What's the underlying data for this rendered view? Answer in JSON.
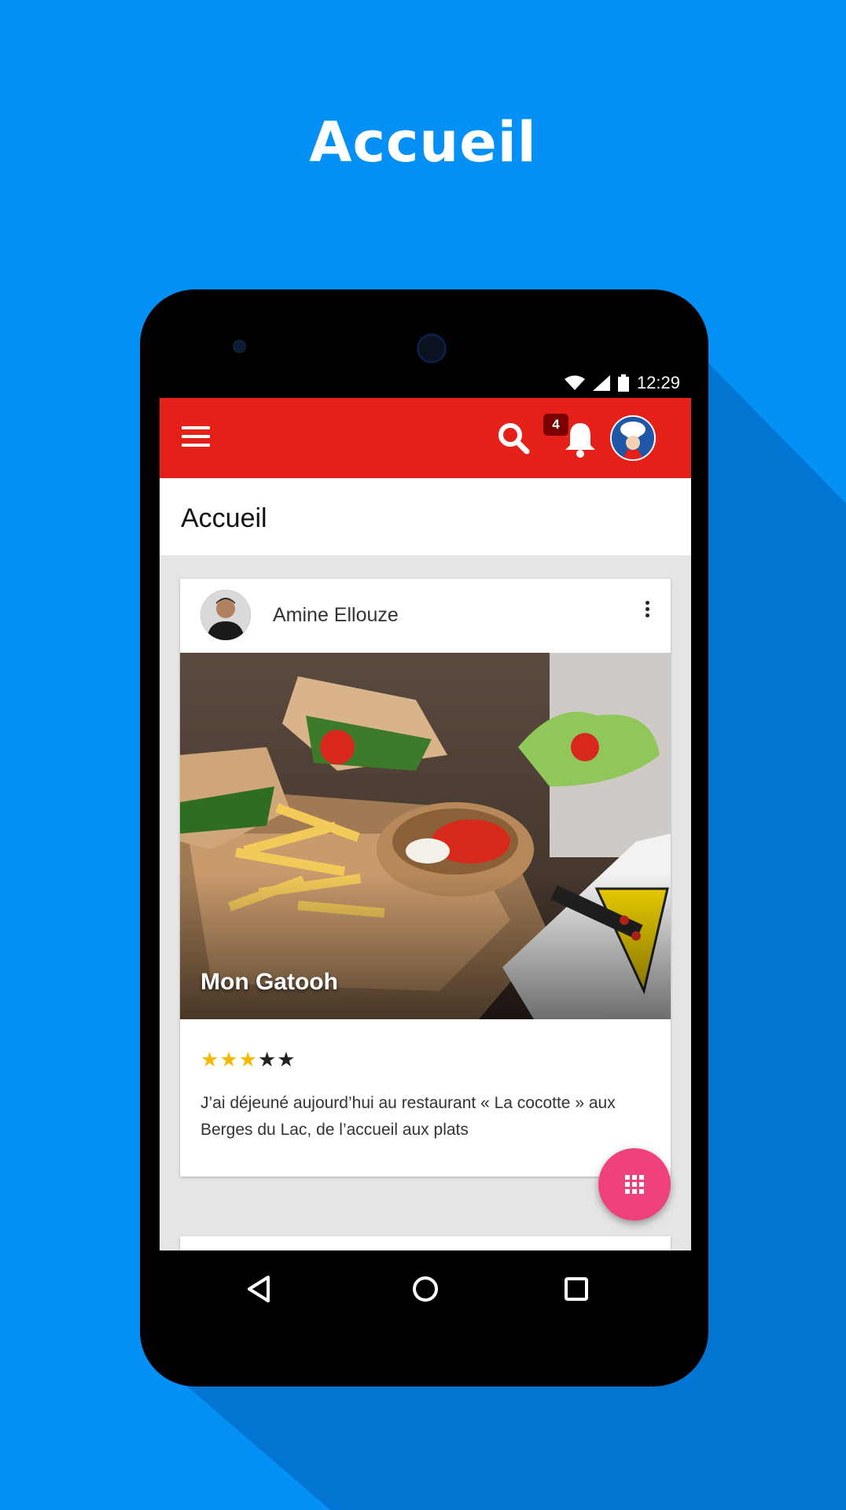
{
  "headline": "Accueil",
  "status_bar": {
    "time": "12:29",
    "icons": [
      "wifi-icon",
      "signal-icon",
      "battery-icon"
    ]
  },
  "app_bar": {
    "icons": [
      "menu-icon",
      "search-icon",
      "bell-icon"
    ],
    "notification_count": "4",
    "color": "#e52019"
  },
  "page": {
    "title": "Accueil"
  },
  "post": {
    "author": "Amine Ellouze",
    "image_caption": "Mon Gatooh",
    "rating": 3,
    "rating_max": 5,
    "review_text": "J’ai déjeuné aujourd’hui au restaurant « La cocotte » aux Berges du Lac, de l’accueil aux plats"
  },
  "fab": {
    "color": "#f0427a",
    "icon": "apps-grid-icon"
  },
  "nav_bar": {
    "icons": [
      "back-icon",
      "home-icon",
      "recents-icon"
    ]
  },
  "colors": {
    "background": "#0490f5",
    "star_filled": "#f6b800",
    "star_empty": "#222222"
  }
}
